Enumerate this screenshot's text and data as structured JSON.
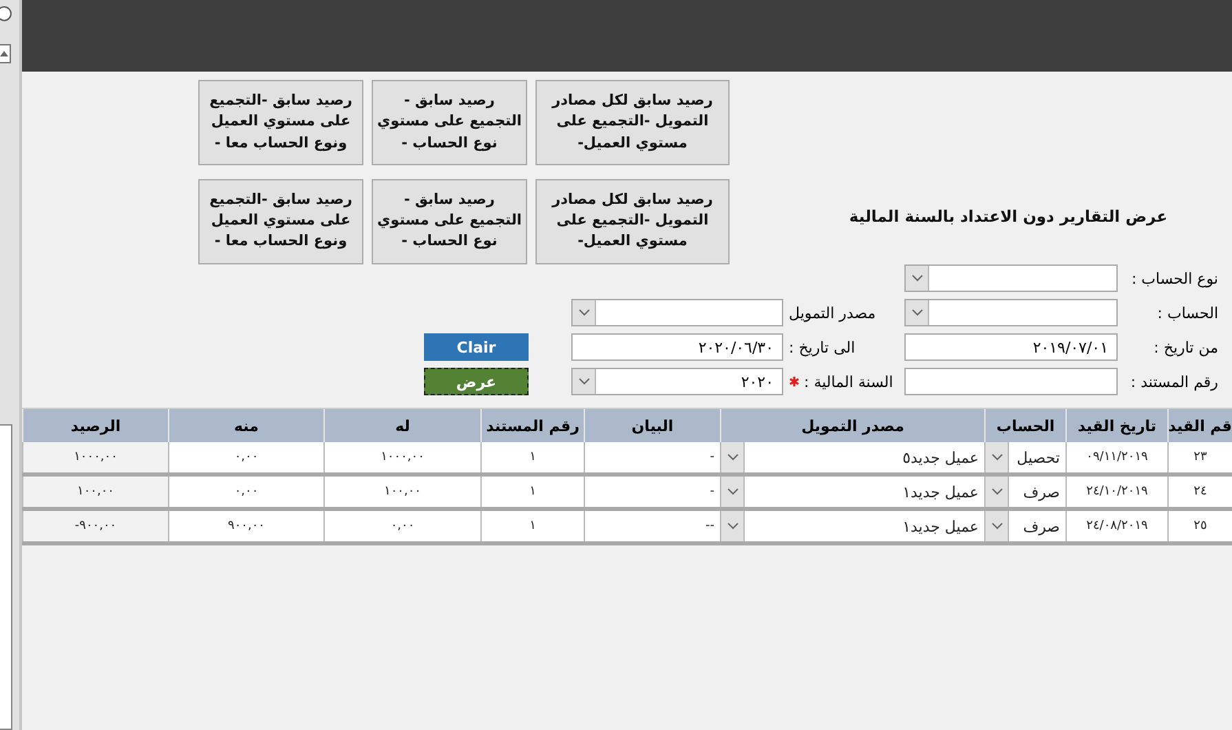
{
  "report_buttons": [
    {
      "label": "رصيد سابق لكل مصادر التمويل -التجميع على مستوي العميل-"
    },
    {
      "label": "رصيد سابق - التجميع على مستوي نوع الحساب -"
    },
    {
      "label": "رصيد سابق -التجميع على مستوي العميل ونوع الحساب معا -"
    },
    {
      "label": "رصيد سابق لكل مصادر التمويل -التجميع على مستوي العميل-"
    },
    {
      "label": "رصيد سابق - التجميع على مستوي نوع الحساب -"
    },
    {
      "label": "رصيد سابق -التجميع على مستوي العميل ونوع الحساب معا -"
    }
  ],
  "form": {
    "title": "عرض التقارير دون الاعتداد بالسنة المالية",
    "rows": [
      {
        "fields": [
          {
            "label": "نوع الحساب :",
            "kind": "combo"
          }
        ]
      },
      {
        "fields": [
          {
            "label": "الحساب :",
            "kind": "combo"
          },
          {
            "label": "مصدر التمويل",
            "kind": "combo"
          }
        ]
      },
      {
        "fields": [
          {
            "label": "من تاريخ :",
            "kind": "text",
            "value": "٢٠١٩/٠٧/٠١"
          },
          {
            "label": "الى تاريخ :",
            "kind": "text",
            "value": "٢٠٢٠/٠٦/٣٠"
          }
        ],
        "action": {
          "label": "Clair",
          "kind": "clear"
        }
      },
      {
        "fields": [
          {
            "label": "رقم المستند :",
            "kind": "text"
          },
          {
            "label": "السنة المالية :",
            "kind": "combo",
            "value": "٢٠٢٠",
            "required": true
          }
        ],
        "action": {
          "label": "عرض",
          "kind": "show"
        }
      }
    ]
  },
  "table": {
    "columns": [
      {
        "label": "قم القيد",
        "kind": "text"
      },
      {
        "label": "تاريخ القيد",
        "kind": "text"
      },
      {
        "label": "الحساب",
        "kind": "combo"
      },
      {
        "label": "مصدر التمويل",
        "kind": "combo"
      },
      {
        "label": "البيان",
        "kind": "text"
      },
      {
        "label": "رقم المستند",
        "kind": "text"
      },
      {
        "label": "له",
        "kind": "text"
      },
      {
        "label": "منه",
        "kind": "text"
      },
      {
        "label": "الرصيد",
        "kind": "shaded"
      }
    ],
    "rows": [
      {
        "cells": [
          "٢٣",
          "٠٩/١١/٢٠١٩",
          "تحصيل",
          "عميل جديد٥",
          "-",
          "١",
          "١٠٠٠,٠٠",
          "٠,٠٠",
          "١٠٠٠,٠٠"
        ]
      },
      {
        "cells": [
          "٢٤",
          "٢٤/١٠/٢٠١٩",
          "صرف",
          "عميل جديد١",
          "-",
          "١",
          "١٠٠,٠٠",
          "٠,٠٠",
          "١٠٠,٠٠"
        ]
      },
      {
        "cells": [
          "٢٥",
          "٢٤/٠٨/٢٠١٩",
          "صرف",
          "عميل جديد١",
          "--",
          "١",
          "٠,٠٠",
          "٩٠٠,٠٠",
          "-٩٠٠,٠٠"
        ]
      }
    ]
  }
}
